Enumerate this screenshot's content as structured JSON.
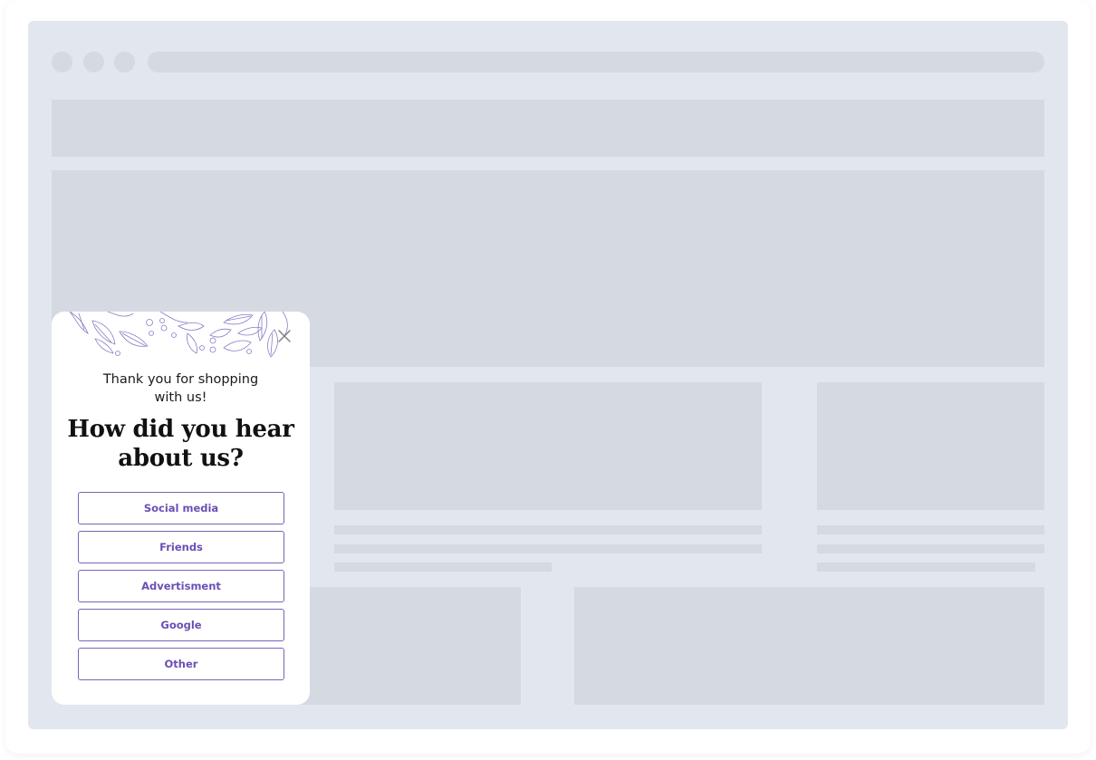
{
  "popup": {
    "subtitle_line1": "Thank you for shopping",
    "subtitle_line2": "with us!",
    "heading_line1": "How did you hear",
    "heading_line2": "about us?",
    "options": [
      {
        "label": "Social media"
      },
      {
        "label": "Friends"
      },
      {
        "label": "Advertisment"
      },
      {
        "label": "Google"
      },
      {
        "label": "Other"
      }
    ],
    "close_icon": "close-icon"
  },
  "colors": {
    "accent": "#6b4fb5",
    "placeholder_bg": "#e2e6ee",
    "placeholder_block": "#d4d9e2"
  }
}
